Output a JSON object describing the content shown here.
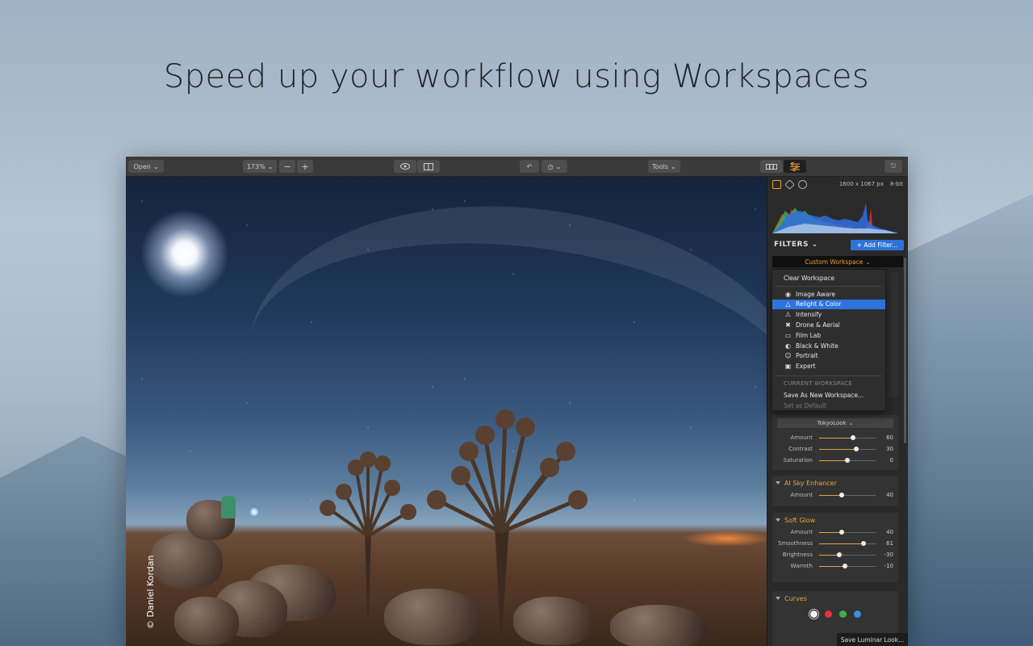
{
  "headline": "Speed up your workflow using Workspaces",
  "toolbar": {
    "open_label": "Open",
    "zoom_label": "173%",
    "zoom_minus": "−",
    "zoom_plus": "+",
    "tools_label": "Tools"
  },
  "photo": {
    "credit": "© Daniel Kordan"
  },
  "panel": {
    "dimensions": "1600 x 1067 px",
    "bit_depth": "8-bit",
    "filters_label": "FILTERS",
    "add_filter_label": "+ Add Filter...",
    "workspace_label": "Custom Workspace",
    "look_label": "TokyoLook",
    "look_sliders": [
      {
        "label": "Amount",
        "value": "60",
        "level": 0.6
      },
      {
        "label": "Contrast",
        "value": "30",
        "level": 0.65
      },
      {
        "label": "Saturation",
        "value": "0",
        "level": 0.5
      }
    ],
    "ai_sky": {
      "title": "AI Sky Enhancer",
      "sliders": [
        {
          "label": "Amount",
          "value": "40",
          "level": 0.4
        }
      ]
    },
    "soft_glow": {
      "title": "Soft Glow",
      "sliders": [
        {
          "label": "Amount",
          "value": "40",
          "level": 0.4
        },
        {
          "label": "Smoothness",
          "value": "61",
          "level": 0.78
        },
        {
          "label": "Brightness",
          "value": "-30",
          "level": 0.35
        },
        {
          "label": "Warmth",
          "value": "-10",
          "level": 0.45
        }
      ]
    },
    "curves": {
      "title": "Curves",
      "channels": [
        "#f2f2f2",
        "#e8323c",
        "#3fae49",
        "#3a8ee6"
      ]
    },
    "save_look_label": "Save Luminar Look...",
    "accent_color": "#f0a13a"
  },
  "dropdown": {
    "clear_label": "Clear Workspace",
    "items": [
      {
        "label": "Image Aware",
        "icon": "eye-icon",
        "glyph": "◉"
      },
      {
        "label": "Relight & Color",
        "icon": "drop-icon",
        "glyph": "△",
        "selected": true
      },
      {
        "label": "Intensify",
        "icon": "warning-icon",
        "glyph": "⚠"
      },
      {
        "label": "Drone & Aerial",
        "icon": "drone-icon",
        "glyph": "✖"
      },
      {
        "label": "Film Lab",
        "icon": "film-icon",
        "glyph": "▭"
      },
      {
        "label": "Black & White",
        "icon": "contrast-icon",
        "glyph": "◐"
      },
      {
        "label": "Portrait",
        "icon": "face-icon",
        "glyph": "☺"
      },
      {
        "label": "Expert",
        "icon": "camera-icon",
        "glyph": "▣"
      }
    ],
    "current_header": "CURRENT WORKSPACE",
    "save_new_label": "Save As New Workspace...",
    "set_default_label": "Set as Default",
    "selection_color": "#2d74da"
  }
}
